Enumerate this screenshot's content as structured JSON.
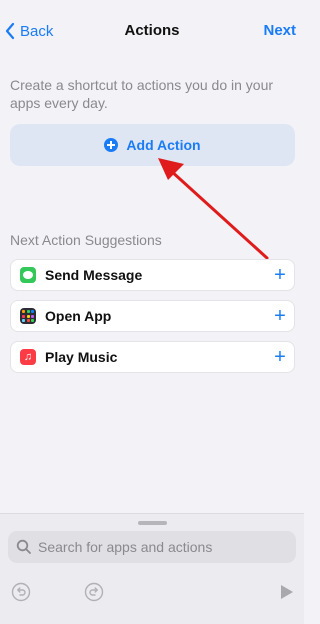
{
  "nav": {
    "back_label": "Back",
    "title": "Actions",
    "next_label": "Next"
  },
  "intro_text": "Create a shortcut to actions you do in your apps every day.",
  "add_action": {
    "label": "Add Action",
    "icon": "plus-circle-icon"
  },
  "suggestions": {
    "header": "Next Action Suggestions",
    "items": [
      {
        "label": "Send Message",
        "icon": "messages-app-icon",
        "color": "#34c759"
      },
      {
        "label": "Open App",
        "icon": "open-app-grid-icon",
        "color": "#2c2c34"
      },
      {
        "label": "Play Music",
        "icon": "music-app-icon",
        "color": "#fc3c44"
      }
    ]
  },
  "search": {
    "placeholder": "Search for apps and actions"
  },
  "toolbar": {
    "undo_icon": "undo-icon",
    "redo_icon": "redo-icon",
    "run_icon": "play-icon"
  },
  "colors": {
    "accent": "#1a7cf5",
    "annotation_arrow": "#e01b1b"
  }
}
